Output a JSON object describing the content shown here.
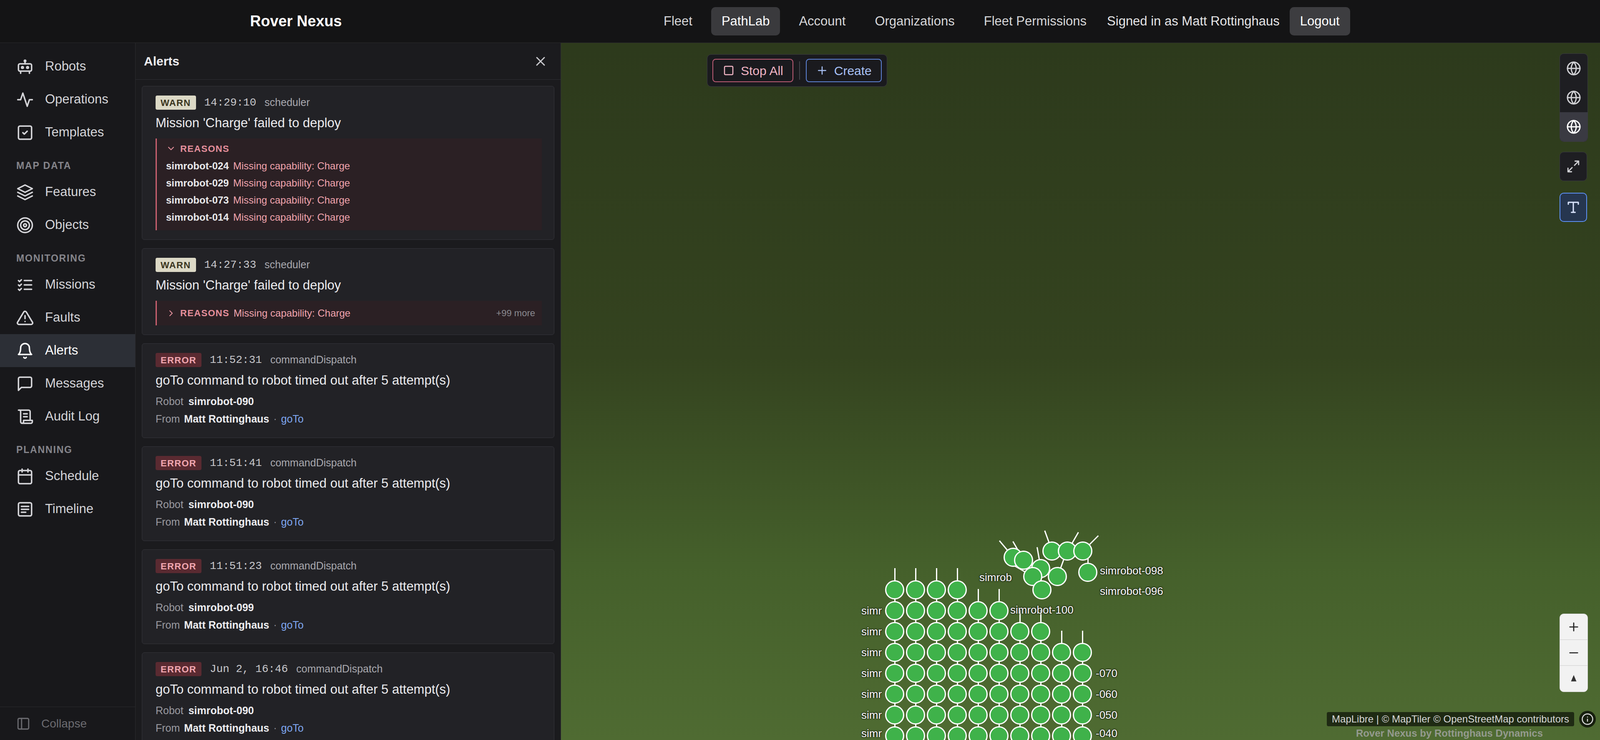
{
  "header": {
    "title": "Rover Nexus",
    "nav": [
      {
        "label": "Fleet",
        "selected": false
      },
      {
        "label": "PathLab",
        "selected": true
      },
      {
        "label": "Account",
        "selected": false
      },
      {
        "label": "Organizations",
        "selected": false
      },
      {
        "label": "Fleet Permissions",
        "selected": false
      }
    ],
    "user": "Signed in as Matt Rottinghaus",
    "logout": "Logout"
  },
  "sidebar": {
    "sections": [
      {
        "items": [
          {
            "label": "Robots",
            "selected": false
          },
          {
            "label": "Operations",
            "selected": false
          },
          {
            "label": "Templates",
            "selected": false
          }
        ]
      },
      {
        "label": "MAP DATA",
        "items": [
          {
            "label": "Features",
            "selected": false
          },
          {
            "label": "Objects",
            "selected": false
          }
        ]
      },
      {
        "label": "MONITORING",
        "items": [
          {
            "label": "Missions",
            "selected": false
          },
          {
            "label": "Faults",
            "selected": false
          },
          {
            "label": "Alerts",
            "selected": true
          },
          {
            "label": "Messages",
            "selected": false
          },
          {
            "label": "Audit Log",
            "selected": false
          }
        ]
      },
      {
        "label": "PLANNING",
        "items": [
          {
            "label": "Schedule",
            "selected": false
          },
          {
            "label": "Timeline",
            "selected": false
          }
        ]
      }
    ],
    "collapse": "Collapse"
  },
  "alerts_panel": {
    "title": "Alerts",
    "alerts": [
      {
        "badge": "WARN",
        "severity": "warn",
        "time": "14:29:10",
        "source": "scheduler",
        "title": "Mission 'Charge' failed to deploy",
        "kind": "reasons",
        "reasons": {
          "label": "REASONS",
          "expanded": true,
          "items": [
            {
              "robot": "simrobot-024",
              "text": "Missing capability: Charge"
            },
            {
              "robot": "simrobot-029",
              "text": "Missing capability: Charge"
            },
            {
              "robot": "simrobot-073",
              "text": "Missing capability: Charge"
            },
            {
              "robot": "simrobot-014",
              "text": "Missing capability: Charge"
            }
          ]
        }
      },
      {
        "badge": "WARN",
        "severity": "warn",
        "time": "14:27:33",
        "source": "scheduler",
        "title": "Mission 'Charge' failed to deploy",
        "kind": "reasons",
        "reasons": {
          "label": "REASONS",
          "expanded": false,
          "summary": "Missing capability: Charge",
          "more": "+99 more"
        }
      },
      {
        "badge": "ERROR",
        "severity": "error",
        "time": "11:52:31",
        "source": "commandDispatch",
        "title": "goTo command to robot timed out after 5 attempt(s)",
        "kind": "robot",
        "robot_label": "Robot",
        "robot": "simrobot-090",
        "from_label": "From",
        "user": "Matt Rottinghaus",
        "separator": "·",
        "action": "goTo"
      },
      {
        "badge": "ERROR",
        "severity": "error",
        "time": "11:51:41",
        "source": "commandDispatch",
        "title": "goTo command to robot timed out after 5 attempt(s)",
        "kind": "robot",
        "robot_label": "Robot",
        "robot": "simrobot-090",
        "from_label": "From",
        "user": "Matt Rottinghaus",
        "separator": "·",
        "action": "goTo"
      },
      {
        "badge": "ERROR",
        "severity": "error",
        "time": "11:51:23",
        "source": "commandDispatch",
        "title": "goTo command to robot timed out after 5 attempt(s)",
        "kind": "robot",
        "robot_label": "Robot",
        "robot": "simrobot-099",
        "from_label": "From",
        "user": "Matt Rottinghaus",
        "separator": "·",
        "action": "goTo"
      },
      {
        "badge": "ERROR",
        "severity": "error",
        "time": "Jun 2, 16:46",
        "source": "commandDispatch",
        "title": "goTo command to robot timed out after 5 attempt(s)",
        "kind": "robot",
        "robot_label": "Robot",
        "robot": "simrobot-090",
        "from_label": "From",
        "user": "Matt Rottinghaus",
        "separator": "·",
        "action": "goTo"
      }
    ]
  },
  "map": {
    "toolbar": {
      "stop_all": "Stop All",
      "create": "Create"
    },
    "layer_buttons": [
      {
        "selected": false
      },
      {
        "selected": false
      },
      {
        "selected": true
      }
    ],
    "labels_toggle": {
      "on": true
    },
    "grid_rows": [
      {
        "count": 4
      },
      {
        "count": 6,
        "left": "simr"
      },
      {
        "count": 8,
        "left": "simr"
      },
      {
        "count": 10,
        "left": "simr"
      },
      {
        "count": 10,
        "left": "simr",
        "right": "-070"
      },
      {
        "count": 10,
        "left": "simr",
        "right": "-060"
      },
      {
        "count": 10,
        "left": "simr",
        "right": "-050"
      },
      {
        "count": 10,
        "left": "simr",
        "right": "-040"
      }
    ],
    "cluster": [
      {
        "heading": -40
      },
      {
        "heading": -30
      },
      {
        "heading": -20
      },
      {
        "heading": 30
      },
      {
        "heading": 45
      },
      {
        "heading": -10
      },
      {
        "heading": -60
      },
      {
        "heading": 20
      },
      {
        "heading": 0
      },
      {
        "heading": -50
      }
    ],
    "robot_labels": [
      "simrobot-098",
      "simrobot-096",
      "simrobot-100",
      "simrob"
    ],
    "attribution": "MapLibre | © MapTiler © OpenStreetMap contributors",
    "watermark": "Rover Nexus by Rottinghaus Dynamics"
  }
}
